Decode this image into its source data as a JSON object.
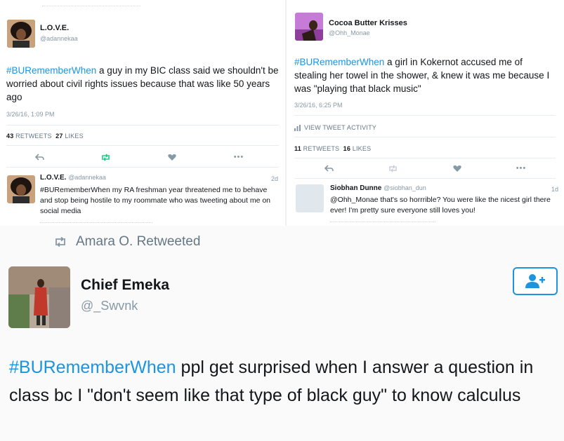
{
  "left": {
    "name": "L.O.V.E.",
    "handle": "@adannekaa",
    "hashtag": "#BURememberWhen",
    "text": " a guy in my BIC class said we shouldn't be worried about civil rights issues because that was like 50 years ago",
    "timestamp": "3/26/16, 1:09 PM",
    "retweets_count": "43",
    "retweets_label": "RETWEETS",
    "likes_count": "27",
    "likes_label": "LIKES",
    "reply": {
      "name": "L.O.V.E.",
      "handle": "@adannekaa",
      "time": "2d",
      "text": "#BURememberWhen my RA freshman year threatened me to behave and stop being hostile to my roommate who was tweeting about me on social media"
    }
  },
  "right": {
    "name": "Cocoa Butter Krisses",
    "handle": "@Ohh_Monae",
    "hashtag": "#BURememberWhen",
    "text": " a girl in Kokernot accused me of stealing her towel in the shower, & knew it was me because I was \"playing that black music\"",
    "timestamp": "3/26/16, 6:25 PM",
    "activity_label": "VIEW TWEET ACTIVITY",
    "retweets_count": "11",
    "retweets_label": "RETWEETS",
    "likes_count": "16",
    "likes_label": "LIKES",
    "reply": {
      "name": "Siobhan Dunne",
      "handle": "@siobhan_dun",
      "time": "1d",
      "text": "@Ohh_Monae that's so horrrible? You were like the nicest girl there ever! I'm pretty sure everyone still loves you!"
    }
  },
  "bottom": {
    "retweeted_by": "Amara O. Retweeted",
    "name": "Chief Emeka",
    "handle": "@_Swvnk",
    "hashtag": "#BURememberWhen",
    "text": " ppl get surprised when I answer a question in class bc I \"don't seem like that type of black guy\" to know calculus"
  },
  "icons": {
    "reply": "reply-icon",
    "retweet": "retweet-icon",
    "like": "heart-icon",
    "more": "more-icon",
    "follow": "follow-user-icon",
    "activity": "bar-chart-icon"
  },
  "colors": {
    "link": "#1b95e0",
    "retweet_green": "#19cf86",
    "like_red": "#e0245e",
    "muted": "#8899a6"
  }
}
